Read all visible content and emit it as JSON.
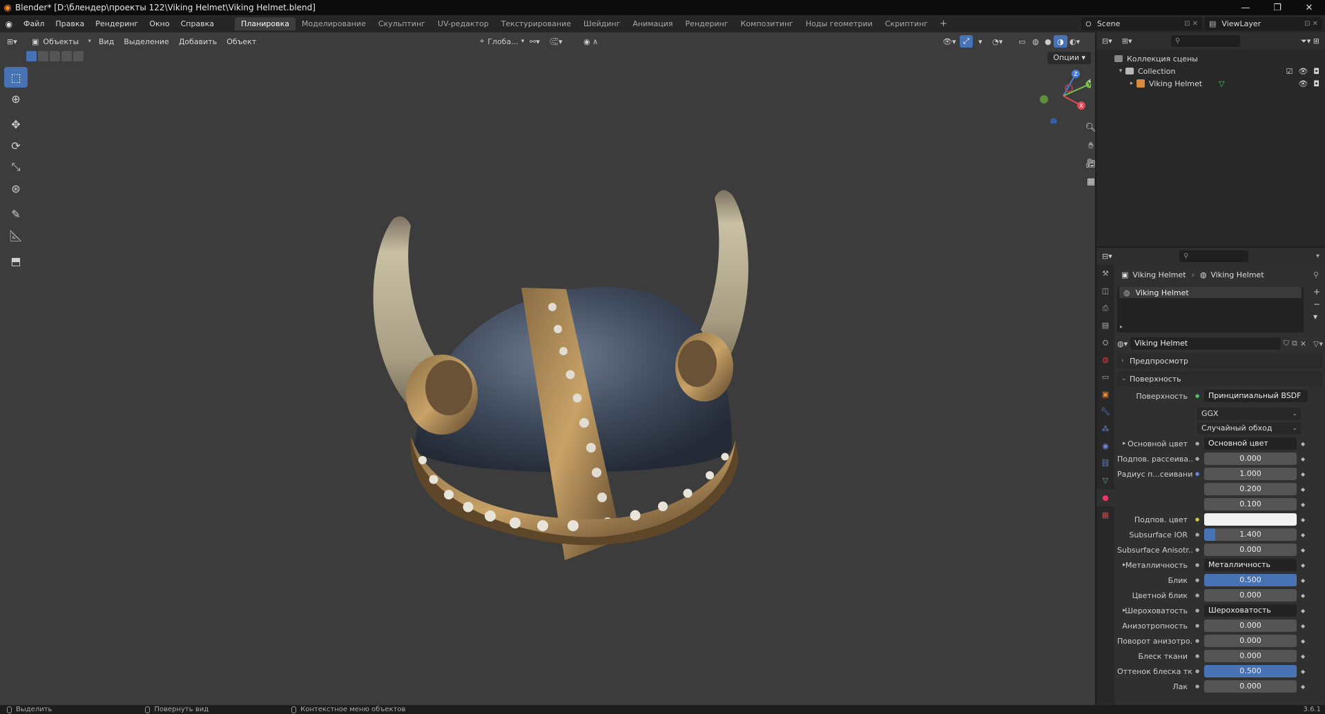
{
  "window": {
    "title": "Blender* [D:\\блендер\\проекты 122\\Viking Helmet\\Viking Helmet.blend]",
    "minimize": "—",
    "maximize": "❐",
    "close": "✕"
  },
  "menu": [
    "Файл",
    "Правка",
    "Рендеринг",
    "Окно",
    "Справка"
  ],
  "workspaces": [
    "Планировка",
    "Моделирование",
    "Скульптинг",
    "UV-редактор",
    "Текстурирование",
    "Шейдинг",
    "Анимация",
    "Рендеринг",
    "Композитинг",
    "Ноды геометрии",
    "Скриптинг"
  ],
  "workspace_add": "+",
  "scene": {
    "name": "Scene",
    "view_layer": "ViewLayer"
  },
  "viewport": {
    "mode": "Объекты",
    "menus": [
      "Вид",
      "Выделение",
      "Добавить",
      "Объект"
    ],
    "orientation": "Глоба...",
    "options": "Опции",
    "gizmo_axes": {
      "z": "Z",
      "y": "Y",
      "x": "X"
    }
  },
  "outliner": {
    "collection_root": "Коллекция сцены",
    "collection": "Collection",
    "object": "Viking Helmet"
  },
  "properties": {
    "breadcrumb_object": "Viking Helmet",
    "breadcrumb_material": "Viking Helmet",
    "slot_name": "Viking Helmet",
    "material_name": "Viking Helmet",
    "panel_preview": "Предпросмотр",
    "panel_surface": "Поверхность",
    "surface_label": "Поверхность",
    "surface_value": "Принципиальный BSDF",
    "distribution": "GGX",
    "subsurface_method": "Случайный обход",
    "rows": [
      {
        "label": "Основной цвет",
        "value": "Основной цвет",
        "type": "socket",
        "expand": true
      },
      {
        "label": "Подпов. рассеива...",
        "value": "0.000",
        "type": "num"
      },
      {
        "label": "Радиус п...сеивания",
        "value": "1.000",
        "type": "num",
        "dot": "b"
      },
      {
        "label": "",
        "value": "0.200",
        "type": "num",
        "nodot": true
      },
      {
        "label": "",
        "value": "0.100",
        "type": "num",
        "nodot": true
      },
      {
        "label": "Подпов. цвет",
        "value": "",
        "type": "color",
        "dot": "y"
      },
      {
        "label": "Subsurface IOR",
        "value": "1.400",
        "type": "num",
        "fill": 0.12
      },
      {
        "label": "Subsurface Anisotr...",
        "value": "0.000",
        "type": "num"
      },
      {
        "label": "Металличность",
        "value": "Металличность",
        "type": "socket",
        "expand": true
      },
      {
        "label": "Блик",
        "value": "0.500",
        "type": "num",
        "fill": 1.0
      },
      {
        "label": "Цветной блик",
        "value": "0.000",
        "type": "num"
      },
      {
        "label": "Шероховатость",
        "value": "Шероховатость",
        "type": "socket",
        "expand": true
      },
      {
        "label": "Анизотропность",
        "value": "0.000",
        "type": "num"
      },
      {
        "label": "Поворот анизотро...",
        "value": "0.000",
        "type": "num"
      },
      {
        "label": "Блеск ткани",
        "value": "0.000",
        "type": "num"
      },
      {
        "label": "Оттенок блеска тк...",
        "value": "0.500",
        "type": "num",
        "fill": 1.0
      },
      {
        "label": "Лак",
        "value": "0.000",
        "type": "num"
      }
    ]
  },
  "status": {
    "select": "Выделить",
    "rotate": "Повернуть вид",
    "context": "Контекстное меню объектов",
    "version": "3.6.1"
  }
}
